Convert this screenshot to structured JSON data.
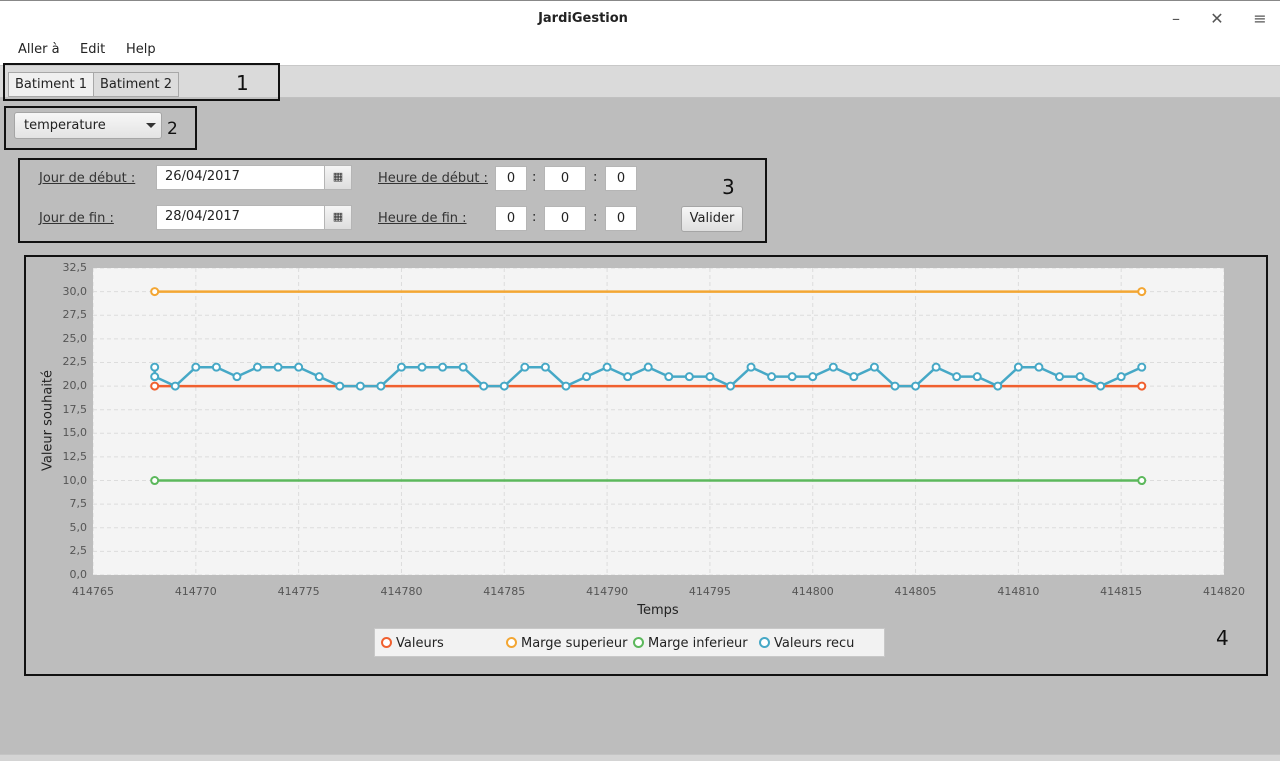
{
  "window": {
    "title": "JardiGestion"
  },
  "menu": {
    "items": [
      "Aller à",
      "Edit",
      "Help"
    ]
  },
  "tabs": [
    "Batiment 1",
    "Batiment 2"
  ],
  "annotations": [
    "1",
    "2",
    "3",
    "4"
  ],
  "sensor_select": {
    "value": "temperature"
  },
  "form": {
    "start_day_label": "Jour de début :",
    "end_day_label": "Jour de fin :",
    "start_day": "26/04/2017",
    "end_day": "28/04/2017",
    "start_time_label": "Heure de début :",
    "end_time_label": "Heure de fin :",
    "start_time": [
      "0",
      "0",
      "0"
    ],
    "end_time": [
      "0",
      "0",
      "0"
    ],
    "submit_label": "Valider"
  },
  "chart_data": {
    "type": "line",
    "xlabel": "Temps",
    "ylabel": "Valeur souhaité",
    "xlim": [
      414765,
      414820
    ],
    "ylim": [
      0,
      32.5
    ],
    "x_ticks": [
      "414765",
      "414770",
      "414775",
      "414780",
      "414785",
      "414790",
      "414795",
      "414800",
      "414805",
      "414810",
      "414815",
      "414820"
    ],
    "y_ticks": [
      "0,0",
      "2,5",
      "5,0",
      "7,5",
      "10,0",
      "12,5",
      "15,0",
      "17,5",
      "20,0",
      "22,5",
      "25,0",
      "27,5",
      "30,0",
      "32,5"
    ],
    "grid": true,
    "legend_position": "bottom",
    "series": [
      {
        "name": "Valeurs",
        "color": "#f0602f",
        "x": [
          414768,
          414816
        ],
        "y": [
          20,
          20
        ]
      },
      {
        "name": "Marge superieur",
        "color": "#f3a633",
        "x": [
          414768,
          414816
        ],
        "y": [
          30,
          30
        ]
      },
      {
        "name": "Marge inferieur",
        "color": "#5cb85c",
        "x": [
          414768,
          414816
        ],
        "y": [
          10,
          10
        ]
      },
      {
        "name": "Valeurs recu",
        "color": "#46a8c6",
        "x": [
          414768,
          414768,
          414769,
          414770,
          414771,
          414772,
          414773,
          414774,
          414775,
          414776,
          414777,
          414778,
          414779,
          414780,
          414781,
          414782,
          414783,
          414784,
          414785,
          414786,
          414787,
          414788,
          414789,
          414790,
          414791,
          414792,
          414793,
          414794,
          414795,
          414796,
          414797,
          414798,
          414799,
          414800,
          414801,
          414802,
          414803,
          414804,
          414805,
          414806,
          414807,
          414808,
          414809,
          414810,
          414811,
          414812,
          414813,
          414814,
          414815,
          414816
        ],
        "y": [
          22,
          21,
          20,
          22,
          22,
          21,
          22,
          22,
          22,
          21,
          20,
          20,
          20,
          22,
          22,
          22,
          22,
          20,
          20,
          22,
          22,
          20,
          21,
          22,
          21,
          22,
          21,
          21,
          21,
          20,
          22,
          21,
          21,
          21,
          22,
          21,
          22,
          20,
          20,
          22,
          21,
          21,
          20,
          22,
          22,
          21,
          21,
          20,
          21,
          22
        ]
      }
    ]
  }
}
